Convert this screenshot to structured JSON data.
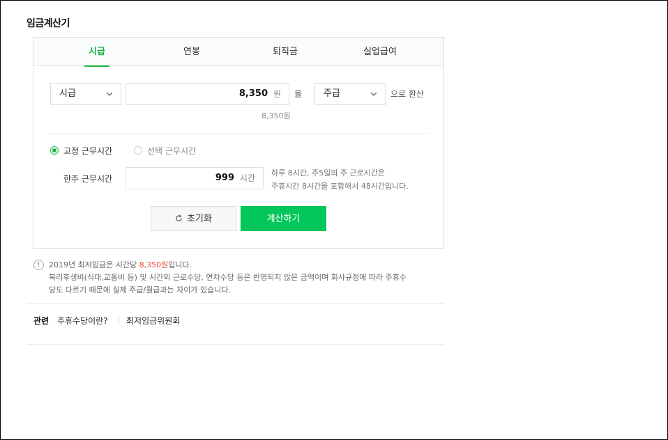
{
  "page": {
    "title": "임금계산기"
  },
  "tabs": [
    {
      "label": "시급",
      "active": true
    },
    {
      "label": "연봉",
      "active": false
    },
    {
      "label": "퇴직금",
      "active": false
    },
    {
      "label": "실업급여",
      "active": false
    }
  ],
  "conversion": {
    "from_unit": "시급",
    "amount": "8,350",
    "amount_unit": "원",
    "particle": "을",
    "to_unit": "주급",
    "suffix": "으로 환산",
    "amount_text": "8,350원"
  },
  "work_hours": {
    "option_fixed": "고정 근무시간",
    "option_select": "선택 근무시간",
    "selected": "fixed",
    "label": "한주 근무시간",
    "value": "999",
    "unit": "시간",
    "hint_line1": "하루 8시간, 주5일의 주 근로시간은",
    "hint_line2": "주휴시간 8시간을 포함해서 48시간입니다."
  },
  "buttons": {
    "reset": "초기화",
    "calculate": "계산하기"
  },
  "notice": {
    "icon": "!",
    "line1_prefix": "2019년 최저임금은 시간당 ",
    "line1_highlight": "8,350원",
    "line1_suffix": "입니다.",
    "line2": "복리후생비(식대,교통비 등) 및 시간외 근로수당, 연차수당 등은 반영되지 않은 금액이며 회사규정에 따라 주휴수",
    "line3": "당도 다르기 때문에 실제 주급/월급과는 차이가 있습니다."
  },
  "related": {
    "label": "관련",
    "links": [
      "주휴수당이란?",
      "최저임금위원회"
    ]
  },
  "colors": {
    "accent": "#1ab440",
    "button": "#03c75a",
    "highlight": "#e84a3a"
  }
}
